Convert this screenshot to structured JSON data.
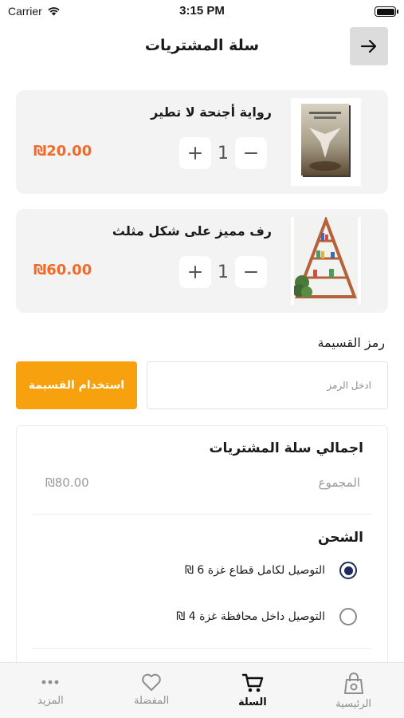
{
  "status_bar": {
    "carrier": "Carrier",
    "time": "3:15 PM"
  },
  "header": {
    "title": "سلة المشتريات"
  },
  "cart_items": [
    {
      "name": "رواية أجنحة لا تطير",
      "price": "₪20.00",
      "quantity": "1",
      "image": "book-cover"
    },
    {
      "name": "رف مميز على شكل مثلث",
      "price": "₪60.00",
      "quantity": "1",
      "image": "triangle-shelf"
    }
  ],
  "coupon": {
    "label": "رمز القسيمة",
    "placeholder": "ادخل الرمز",
    "button_label": "استخدام القسيمة"
  },
  "summary": {
    "title": "اجمالي سلة المشتريات",
    "subtotal_label": "المجموع",
    "subtotal_value": "₪80.00",
    "shipping_title": "الشحن",
    "shipping_options": [
      {
        "label": "التوصيل لكامل قطاع غزة 6 ₪",
        "selected": true
      },
      {
        "label": "التوصيل داخل محافظة غزة 4 ₪",
        "selected": false
      }
    ]
  },
  "tabs": [
    {
      "label": "الرئيسية",
      "icon": "shopping-bag-icon",
      "active": false
    },
    {
      "label": "السلة",
      "icon": "cart-icon",
      "active": true
    },
    {
      "label": "المفضلة",
      "icon": "heart-icon",
      "active": false
    },
    {
      "label": "المزيد",
      "icon": "more-icon",
      "active": false
    }
  ],
  "colors": {
    "price": "#f06a2a",
    "accent_button": "#f8a10e",
    "radio_selected": "#1d2a5a"
  }
}
